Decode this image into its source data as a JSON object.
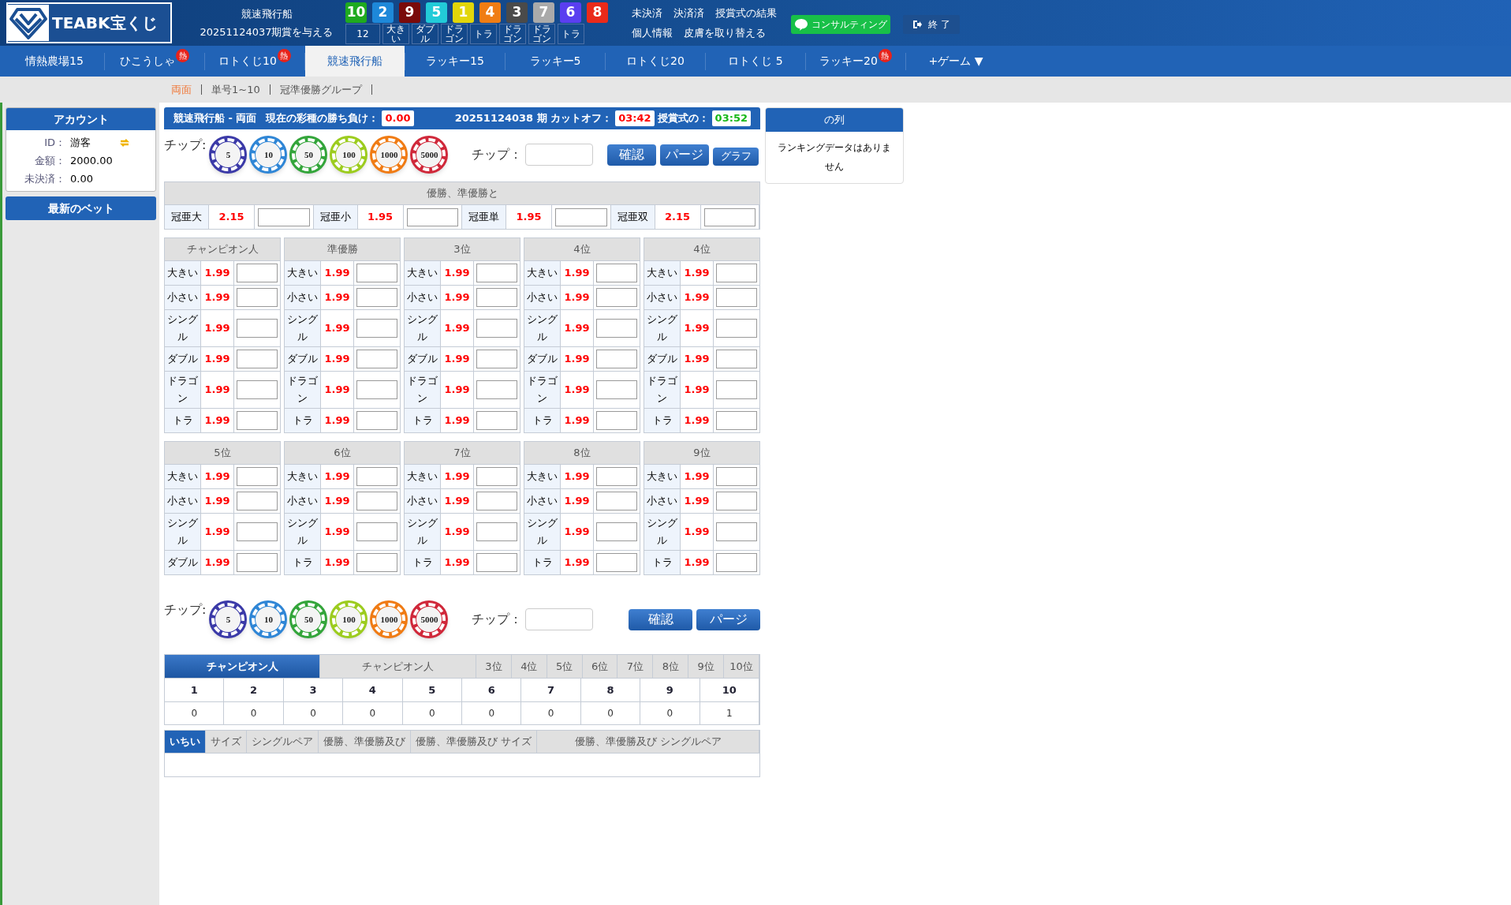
{
  "header": {
    "logo_text": "TEABK宝くじ",
    "game": "競速飛行船",
    "draw": "20251124037期賞を与える",
    "balls": [
      {
        "number": "10",
        "color": "#1faa1f"
      },
      {
        "number": "2",
        "color": "#1e88d9"
      },
      {
        "number": "9",
        "color": "#7a0a0a"
      },
      {
        "number": "5",
        "color": "#22cbd8"
      },
      {
        "number": "1",
        "color": "#e2d60a"
      },
      {
        "number": "4",
        "color": "#f07d14"
      },
      {
        "number": "3",
        "color": "#4a4a4a"
      },
      {
        "number": "7",
        "color": "#aaaaaa"
      },
      {
        "number": "6",
        "color": "#5a3ff0"
      },
      {
        "number": "8",
        "color": "#ea2a1a"
      }
    ],
    "summary": [
      {
        "text": "12",
        "wide": true
      },
      {
        "text": "大きい",
        "wide": false
      },
      {
        "text": "ダブル",
        "wide": false
      },
      {
        "text": "ドラゴン",
        "wide": false
      },
      {
        "text": "トラ",
        "wide": false
      },
      {
        "text": "ドラゴン",
        "wide": false
      },
      {
        "text": "ドラゴン",
        "wide": false
      },
      {
        "text": "トラ",
        "wide": false
      }
    ],
    "links_top": [
      "未決済",
      "決済済",
      "授賞式の結果"
    ],
    "links_bottom": [
      "個人情報",
      "皮膚を取り替える"
    ],
    "line_button": "コンサルティング",
    "logout": "終 了"
  },
  "nav": [
    {
      "label": "情熱農場15",
      "selected": false
    },
    {
      "label": "ひこうしゃ",
      "selected": false,
      "badge": "熱"
    },
    {
      "label": "ロトくじ10",
      "selected": false,
      "badge": "熱"
    },
    {
      "label": "競速飛行船",
      "selected": true
    },
    {
      "label": "ラッキー15",
      "selected": false
    },
    {
      "label": "ラッキー5",
      "selected": false
    },
    {
      "label": "ロトくじ20",
      "selected": false
    },
    {
      "label": "ロトくじ 5",
      "selected": false
    },
    {
      "label": "ラッキー20",
      "selected": false,
      "badge": "熱"
    },
    {
      "label": "+ゲーム ▼",
      "selected": false
    }
  ],
  "subnav": [
    {
      "label": "両面",
      "selected": true
    },
    {
      "label": "単号1~10",
      "selected": false
    },
    {
      "label": "冠準優勝グループ",
      "selected": false
    }
  ],
  "account": {
    "title": "アカウント",
    "rows": [
      {
        "label": "ID：",
        "value": "游客",
        "refresh": true
      },
      {
        "label": "金額：",
        "value": "2000.00",
        "refresh": false
      },
      {
        "label": "未決済：",
        "value": "0.00",
        "refresh": false
      }
    ],
    "latest_bets": "最新のベット"
  },
  "status_bar": {
    "title": "競速飛行船 - 両面",
    "pnl_label": "現在の彩種の勝ち負け：",
    "pnl": "0.00",
    "period": "20251124038 期 カットオフ：",
    "cutoff": "03:42",
    "award_label": "授賞式の：",
    "award": "03:52"
  },
  "chips": {
    "label": "チップ:",
    "items": [
      {
        "value": "5",
        "color": "#3b3aa8"
      },
      {
        "value": "10",
        "color": "#2f86d6"
      },
      {
        "value": "50",
        "color": "#33a53a"
      },
      {
        "value": "100",
        "color": "#9ccc1e"
      },
      {
        "value": "1000",
        "color": "#f07b14"
      },
      {
        "value": "5000",
        "color": "#d0283a"
      }
    ],
    "amount_label": "チップ：",
    "confirm": "確認",
    "clear": "パージ",
    "graph": "グラフ"
  },
  "top_two": {
    "title": "優勝、準優勝と",
    "items": [
      {
        "label": "冠亜大",
        "odds": "2.15"
      },
      {
        "label": "冠亜小",
        "odds": "1.95"
      },
      {
        "label": "冠亜単",
        "odds": "1.95"
      },
      {
        "label": "冠亜双",
        "odds": "2.15"
      }
    ]
  },
  "positions": [
    {
      "title": "チャンピオン人",
      "rows": [
        {
          "label": "大きい",
          "odds": "1.99"
        },
        {
          "label": "小さい",
          "odds": "1.99"
        },
        {
          "label": "シングル",
          "odds": "1.99"
        },
        {
          "label": "ダブル",
          "odds": "1.99"
        },
        {
          "label": "ドラゴン",
          "odds": "1.99"
        },
        {
          "label": "トラ",
          "odds": "1.99"
        }
      ]
    },
    {
      "title": "準優勝",
      "rows": [
        {
          "label": "大きい",
          "odds": "1.99"
        },
        {
          "label": "小さい",
          "odds": "1.99"
        },
        {
          "label": "シングル",
          "odds": "1.99"
        },
        {
          "label": "ダブル",
          "odds": "1.99"
        },
        {
          "label": "ドラゴン",
          "odds": "1.99"
        },
        {
          "label": "トラ",
          "odds": "1.99"
        }
      ]
    },
    {
      "title": "3位",
      "rows": [
        {
          "label": "大きい",
          "odds": "1.99"
        },
        {
          "label": "小さい",
          "odds": "1.99"
        },
        {
          "label": "シングル",
          "odds": "1.99"
        },
        {
          "label": "ダブル",
          "odds": "1.99"
        },
        {
          "label": "ドラゴン",
          "odds": "1.99"
        },
        {
          "label": "トラ",
          "odds": "1.99"
        }
      ]
    },
    {
      "title": "4位",
      "rows": [
        {
          "label": "大きい",
          "odds": "1.99"
        },
        {
          "label": "小さい",
          "odds": "1.99"
        },
        {
          "label": "シングル",
          "odds": "1.99"
        },
        {
          "label": "ダブル",
          "odds": "1.99"
        },
        {
          "label": "ドラゴン",
          "odds": "1.99"
        },
        {
          "label": "トラ",
          "odds": "1.99"
        }
      ]
    },
    {
      "title": "4位",
      "rows": [
        {
          "label": "大きい",
          "odds": "1.99"
        },
        {
          "label": "小さい",
          "odds": "1.99"
        },
        {
          "label": "シングル",
          "odds": "1.99"
        },
        {
          "label": "ダブル",
          "odds": "1.99"
        },
        {
          "label": "ドラゴン",
          "odds": "1.99"
        },
        {
          "label": "トラ",
          "odds": "1.99"
        }
      ]
    },
    {
      "title": "5位",
      "rows": [
        {
          "label": "大きい",
          "odds": "1.99"
        },
        {
          "label": "小さい",
          "odds": "1.99"
        },
        {
          "label": "シングル",
          "odds": "1.99"
        },
        {
          "label": "ダブル",
          "odds": "1.99"
        }
      ]
    },
    {
      "title": "6位",
      "rows": [
        {
          "label": "大きい",
          "odds": "1.99"
        },
        {
          "label": "小さい",
          "odds": "1.99"
        },
        {
          "label": "シングル",
          "odds": "1.99"
        },
        {
          "label": "トラ",
          "odds": "1.99"
        }
      ]
    },
    {
      "title": "7位",
      "rows": [
        {
          "label": "大きい",
          "odds": "1.99"
        },
        {
          "label": "小さい",
          "odds": "1.99"
        },
        {
          "label": "シングル",
          "odds": "1.99"
        },
        {
          "label": "トラ",
          "odds": "1.99"
        }
      ]
    },
    {
      "title": "8位",
      "rows": [
        {
          "label": "大きい",
          "odds": "1.99"
        },
        {
          "label": "小さい",
          "odds": "1.99"
        },
        {
          "label": "シングル",
          "odds": "1.99"
        },
        {
          "label": "トラ",
          "odds": "1.99"
        }
      ]
    },
    {
      "title": "9位",
      "rows": [
        {
          "label": "大きい",
          "odds": "1.99"
        },
        {
          "label": "小さい",
          "odds": "1.99"
        },
        {
          "label": "シングル",
          "odds": "1.99"
        },
        {
          "label": "トラ",
          "odds": "1.99"
        }
      ]
    }
  ],
  "chips_bottom": {
    "label": "チップ:",
    "items": [
      {
        "value": "5",
        "color": "#3b3aa8"
      },
      {
        "value": "10",
        "color": "#2f86d6"
      },
      {
        "value": "50",
        "color": "#33a53a"
      },
      {
        "value": "100",
        "color": "#9ccc1e"
      },
      {
        "value": "1000",
        "color": "#f07b14"
      },
      {
        "value": "5000",
        "color": "#d0283a"
      }
    ],
    "amount_label": "チップ：",
    "confirm": "確認",
    "clear": "パージ"
  },
  "stats": {
    "tabs": [
      {
        "label": "チャンピオン人",
        "selected": true
      },
      {
        "label": "チャンピオン人",
        "selected": false
      },
      {
        "label": "3位",
        "selected": false
      },
      {
        "label": "4位",
        "selected": false
      },
      {
        "label": "5位",
        "selected": false
      },
      {
        "label": "6位",
        "selected": false
      },
      {
        "label": "7位",
        "selected": false
      },
      {
        "label": "8位",
        "selected": false
      },
      {
        "label": "9位",
        "selected": false
      },
      {
        "label": "10位",
        "selected": false
      }
    ],
    "numbers": [
      "1",
      "2",
      "3",
      "4",
      "5",
      "6",
      "7",
      "8",
      "9",
      "10"
    ],
    "counts": [
      "0",
      "0",
      "0",
      "0",
      "0",
      "0",
      "0",
      "0",
      "0",
      "1"
    ]
  },
  "trend_tabs": [
    {
      "label": "いちい",
      "selected": true
    },
    {
      "label": "サイズ",
      "selected": false
    },
    {
      "label": "シングルペア",
      "selected": false
    },
    {
      "label": "優勝、準優勝及び",
      "selected": false
    },
    {
      "label": "優勝、準優勝及び サイズ",
      "selected": false
    },
    {
      "label": "優勝、準優勝及び シングルペア",
      "selected": false
    }
  ],
  "ranking": {
    "title": "の列",
    "empty": "ランキングデータはありません"
  }
}
